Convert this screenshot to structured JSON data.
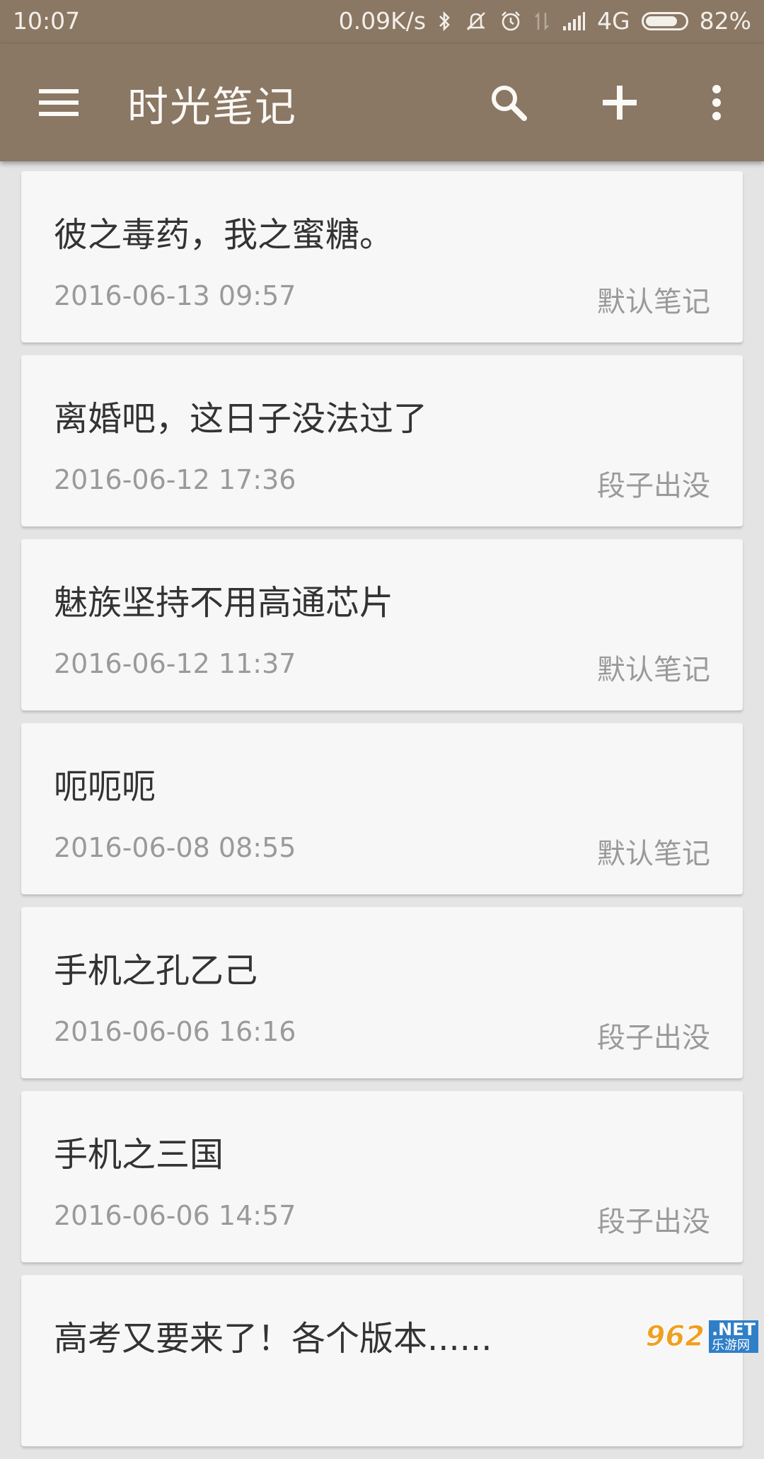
{
  "status_bar": {
    "time": "10:07",
    "network_speed": "0.09K/s",
    "network_type": "4G",
    "battery_percent": "82%",
    "battery_level": 0.82,
    "icons": [
      "bluetooth-icon",
      "mute-icon",
      "alarm-icon",
      "data-transfer-icon",
      "signal-icon",
      "battery-icon"
    ]
  },
  "toolbar": {
    "title": "时光笔记",
    "icons": [
      "menu-icon",
      "search-icon",
      "add-icon",
      "more-vert-icon"
    ]
  },
  "notes": [
    {
      "title": "彼之毒药，我之蜜糖。",
      "date": "2016-06-13 09:57",
      "category": "默认笔记"
    },
    {
      "title": "离婚吧，这日子没法过了",
      "date": "2016-06-12 17:36",
      "category": "段子出没"
    },
    {
      "title": "魅族坚持不用高通芯片",
      "date": "2016-06-12 11:37",
      "category": "默认笔记"
    },
    {
      "title": "呃呃呃",
      "date": "2016-06-08 08:55",
      "category": "默认笔记"
    },
    {
      "title": "手机之孔乙己",
      "date": "2016-06-06 16:16",
      "category": "段子出没"
    },
    {
      "title": "手机之三国",
      "date": "2016-06-06 14:57",
      "category": "段子出没"
    },
    {
      "title": "高考又要来了！各个版本......",
      "date": "",
      "category": ""
    }
  ],
  "watermark": {
    "number": "962",
    "net": ".NET",
    "cn": "乐游网"
  },
  "colors": {
    "toolbar": "#8a7764",
    "card": "#f7f7f7",
    "background": "#e4e4e4",
    "title_text": "#333333",
    "secondary_text": "#9a9a9a"
  }
}
